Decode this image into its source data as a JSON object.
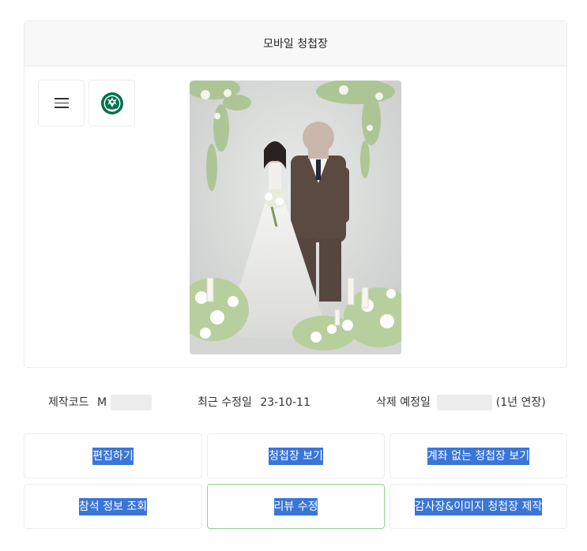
{
  "header": {
    "title": "모바일 청첩장"
  },
  "sidebar": {
    "menu_icon": "hamburger-menu-icon",
    "logo_icon": "starbucks-siren-logo"
  },
  "photo": {
    "alt": "wedding photo",
    "subject": "bride and groom with white flowers"
  },
  "info": {
    "code_label": "제작코드",
    "code_value": "M",
    "modified_label": "최근 수정일",
    "modified_value": "23-10-11",
    "delete_label": "삭제 예정일",
    "extend_label": "(1년 연장)"
  },
  "buttons": {
    "edit": "편집하기",
    "view": "청첩장 보기",
    "view_no_account": "계좌 없는 청첩장 보기",
    "rsvp": "참석 정보 조회",
    "review": "리뷰 수정",
    "thanks": "감사장&이미지 청첩장 제작"
  },
  "colors": {
    "accent_selection": "#3a75d8",
    "active_border": "#8fd48f",
    "starbucks_green": "#00704a"
  }
}
